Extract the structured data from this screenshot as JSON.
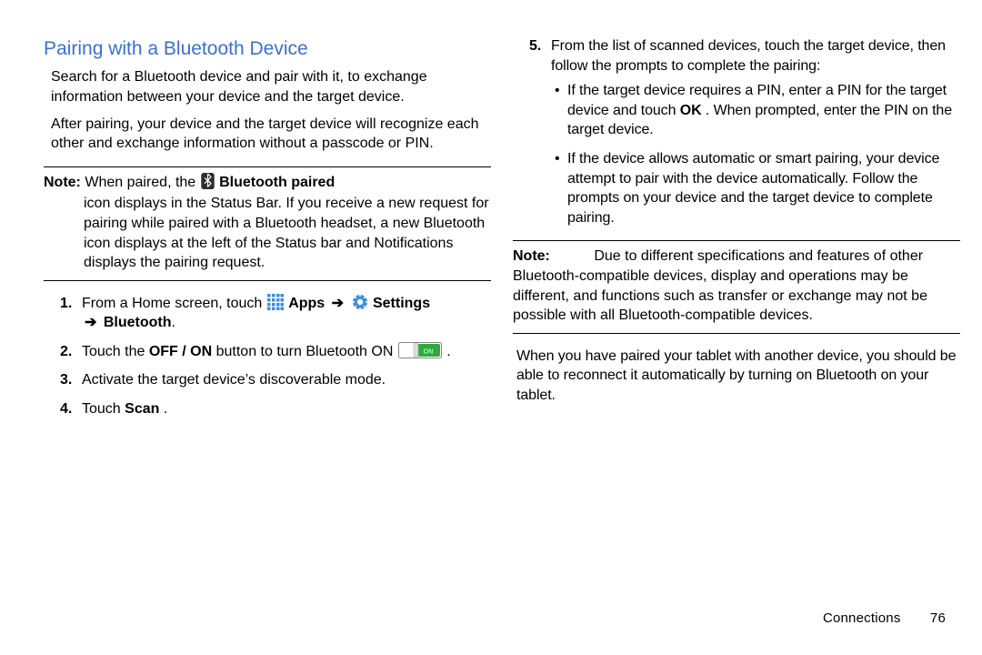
{
  "heading": "Pairing with a Bluetooth Device",
  "p1": "Search for a Bluetooth device and pair with it, to exchange information between your device and the target device.",
  "p2": "After pairing, your device and the target device will recognize each other and exchange information without a passcode or PIN.",
  "note1": {
    "label": "Note:",
    "before_icon": "When paired, the",
    "bold_after_icon": "Bluetooth paired",
    "rest": " icon displays in the Status Bar. If you receive a new request for pairing while paired with a Bluetooth headset, a new Bluetooth icon displays at the left of the Status bar and Notifications displays the pairing request."
  },
  "steps": {
    "s1_a": "From a Home screen, touch ",
    "s1_apps": "Apps",
    "s1_settings": "Settings",
    "s1_bluetooth": "Bluetooth",
    "arrow": "➔",
    "s2_a": "Touch the ",
    "s2_bold": "OFF / ON",
    "s2_b": " button to turn Bluetooth ON ",
    "s2_c": ".",
    "s3": "Activate the target device’s discoverable mode.",
    "s4_a": "Touch ",
    "s4_b": "Scan",
    "s4_c": "."
  },
  "right": {
    "s5_intro": "From the list of scanned devices, touch the target device, then follow the prompts to complete the pairing:",
    "b1_a": "If the target device requires a PIN, enter a PIN for the target device and touch ",
    "b1_ok": "OK",
    "b1_b": ". When prompted, enter the PIN on the target device.",
    "b2": "If the device allows automatic or smart pairing, your device attempt to pair with the device automatically. Follow the prompts on your device and the target device to complete pairing.",
    "note2_label": "Note:",
    "note2_body": "Due to different specifications and features of other Bluetooth-compatible devices, display and operations may be different, and functions such as transfer or exchange may not be possible with all Bluetooth-compatible devices.",
    "closing": "When you have paired your tablet with another device, you should be able to reconnect it automatically by turning on Bluetooth on your tablet."
  },
  "footer": {
    "section": "Connections",
    "page": "76"
  },
  "icons": {
    "bluetooth": "bluetooth-icon",
    "apps_grid": "apps-grid-icon",
    "settings_gear": "settings-gear-icon",
    "toggle_on": "toggle-on-icon"
  }
}
